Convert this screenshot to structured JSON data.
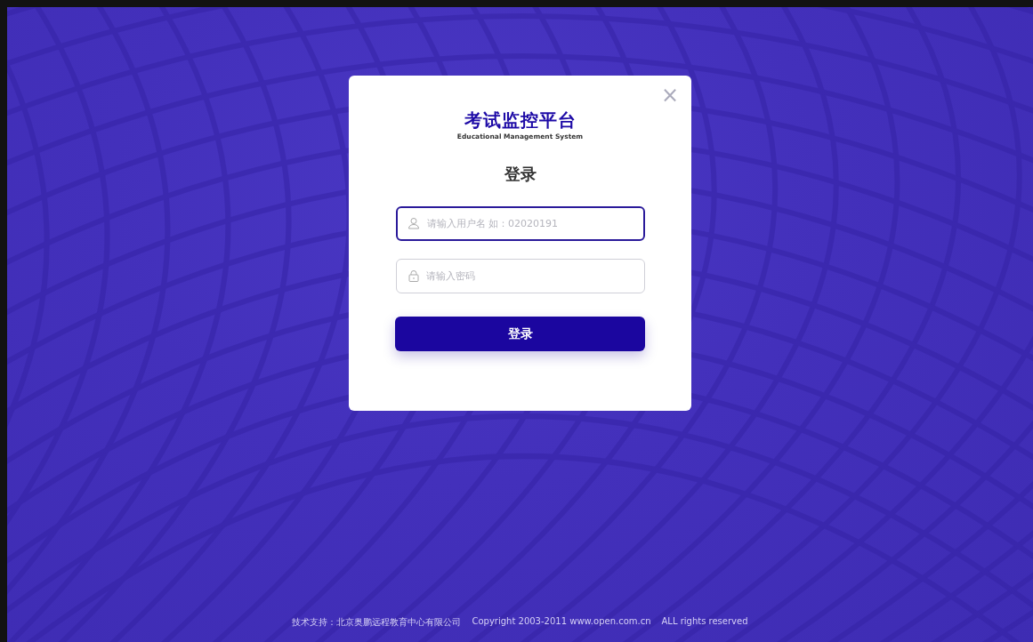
{
  "dialog": {
    "title": "考试监控平台",
    "subtitle": "Educational Management System",
    "heading": "登录",
    "close_icon": "×",
    "fields": [
      {
        "kind": "user",
        "placeholder": "请输入用户名 如：02020191",
        "focused": true
      },
      {
        "kind": "lock",
        "placeholder": "请输入密码",
        "focused": false
      }
    ],
    "submit": "登录"
  },
  "footer": [
    "技术支持：北京奥鹏远程教育中心有限公司",
    "Copyright 2003-2011 www.open.com.cn",
    "ALL rights reserved"
  ]
}
